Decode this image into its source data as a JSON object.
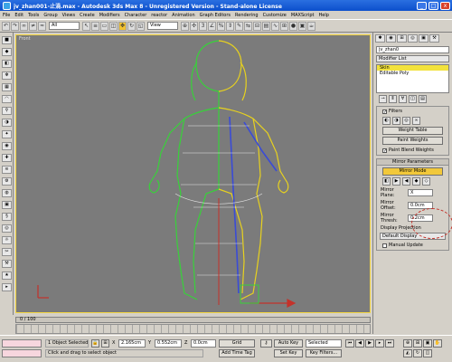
{
  "window": {
    "title": "jv_zhan001-止渦.max - Autodesk 3ds Max 8 - Unregistered Version - Stand-alone License",
    "minimize": "_",
    "maximize": "□",
    "close": "x"
  },
  "menu": [
    "File",
    "Edit",
    "Tools",
    "Group",
    "Views",
    "Create",
    "Modifiers",
    "Character",
    "reactor",
    "Animation",
    "Graph Editors",
    "Rendering",
    "Customize",
    "MAXScript",
    "Help"
  ],
  "toolbar": {
    "selection_filter": "All",
    "reference_coord": "View"
  },
  "viewport": {
    "label": "Front"
  },
  "command_panel": {
    "object_name": "jv_zhan0",
    "modifier_list": "Modifier List",
    "stack": [
      "Skin",
      "Editable Poly"
    ],
    "params": {
      "weight_table": "Weight Table",
      "paint_weights": "Paint Weights",
      "paint_blend": "Paint Blend Weights",
      "filter_label": "Filters"
    },
    "mirror": {
      "header": "Mirror Parameters",
      "mirror_mode": "Mirror Mode",
      "mirror_plane_label": "Mirror Plane:",
      "mirror_plane_value": "X",
      "mirror_offset_label": "Mirror Offset:",
      "mirror_offset_value": "0.0cm",
      "mirror_thresh_label": "Mirror Thresh:",
      "mirror_thresh_value": "0.2cm",
      "display_projection_label": "Display Projection",
      "display_projection_value": "Default Display",
      "manual_update": "Manual Update"
    }
  },
  "time_slider": {
    "label": "0 / 100"
  },
  "status": {
    "object_selected": "1 Object Selected",
    "prompt": "Click and drag to select object",
    "x_value": "2.165cm",
    "y_value": "0.552cm",
    "z_value": "0.0cm",
    "add_time_tag": "Add Time Tag",
    "auto_key": "Auto Key",
    "set_key": "Set Key",
    "selected": "Selected",
    "key_filters": "Key Filters..."
  }
}
